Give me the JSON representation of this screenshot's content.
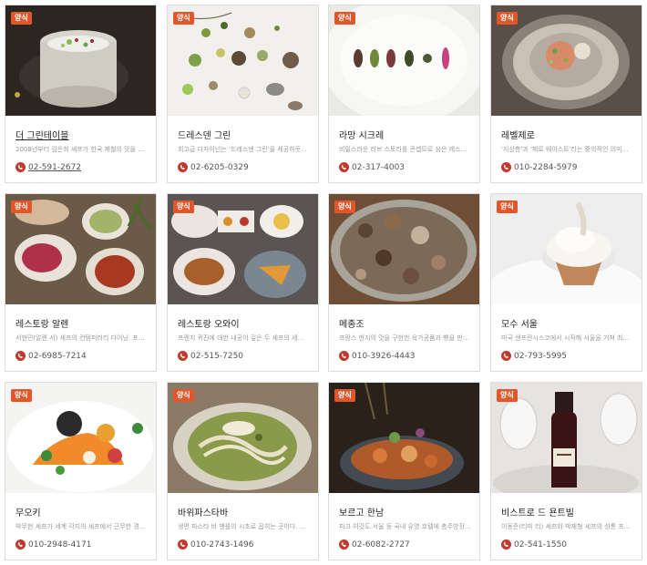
{
  "restaurants": [
    {
      "badge": "양식",
      "name": "더 그린테이블",
      "desc": "2008년부터 김은희 셰프가 한국 제철의 맛을 음...",
      "phone": "02-591-2672"
    },
    {
      "badge": "양식",
      "name": "드레스덴 그린",
      "desc": "최고급 디자이넌는 '드레스덴 그린'을 세공하듯...",
      "phone": "02-6205-0329"
    },
    {
      "badge": "양식",
      "name": "라망 시크레",
      "desc": "비밀스러운 러브 스토리를 콘셉트로 삼은 레스케...",
      "phone": "02-317-4003"
    },
    {
      "badge": "양식",
      "name": "레벨제로",
      "desc": "'지상층'과 '제로 웨이스트'라는 중의적인 의미가 ...",
      "phone": "010-2284-5979"
    },
    {
      "badge": "양식",
      "name": "레스토랑 알렌",
      "desc": "서현민(알렌 서) 셰프의 컨템퍼러리 다이닝. 프랜...",
      "phone": "02-6985-7214"
    },
    {
      "badge": "양식",
      "name": "레스토랑 오와이",
      "desc": "프렌치 퀴진에 대한 내공이 깊은 두 셰프의 세...",
      "phone": "02-515-7250"
    },
    {
      "badge": "양식",
      "name": "메종조",
      "desc": "프랑스 현지의 맛을 구현한 육가공품과 빵을 판매...",
      "phone": "010-3926-4443"
    },
    {
      "badge": "양식",
      "name": "모수 서울",
      "desc": "미국 샌프란시스코에서 시작해 서울을 거쳐 최근 ...",
      "phone": "02-793-5995"
    },
    {
      "badge": "양식",
      "name": "무오키",
      "desc": "박무현 셰프가 세계 각지의 셰프에서 근무한 경험...",
      "phone": "010-2948-4171"
    },
    {
      "badge": "양식",
      "name": "바위파스타바",
      "desc": "생면 파스타 바 맨를의 시초로 꼽히는 곳이다. 제...",
      "phone": "010-2743-1496"
    },
    {
      "badge": "양식",
      "name": "보르고 한남",
      "desc": "피크 히갓도 서울 등 국내 유명 호텔에 총주방장...",
      "phone": "02-6082-2727"
    },
    {
      "badge": "양식",
      "name": "비스트로 드 욘트빌",
      "desc": "이동준(티미 리) 셰프와 박재형 셰프의 성통 프랜...",
      "phone": "02-541-1550"
    }
  ]
}
